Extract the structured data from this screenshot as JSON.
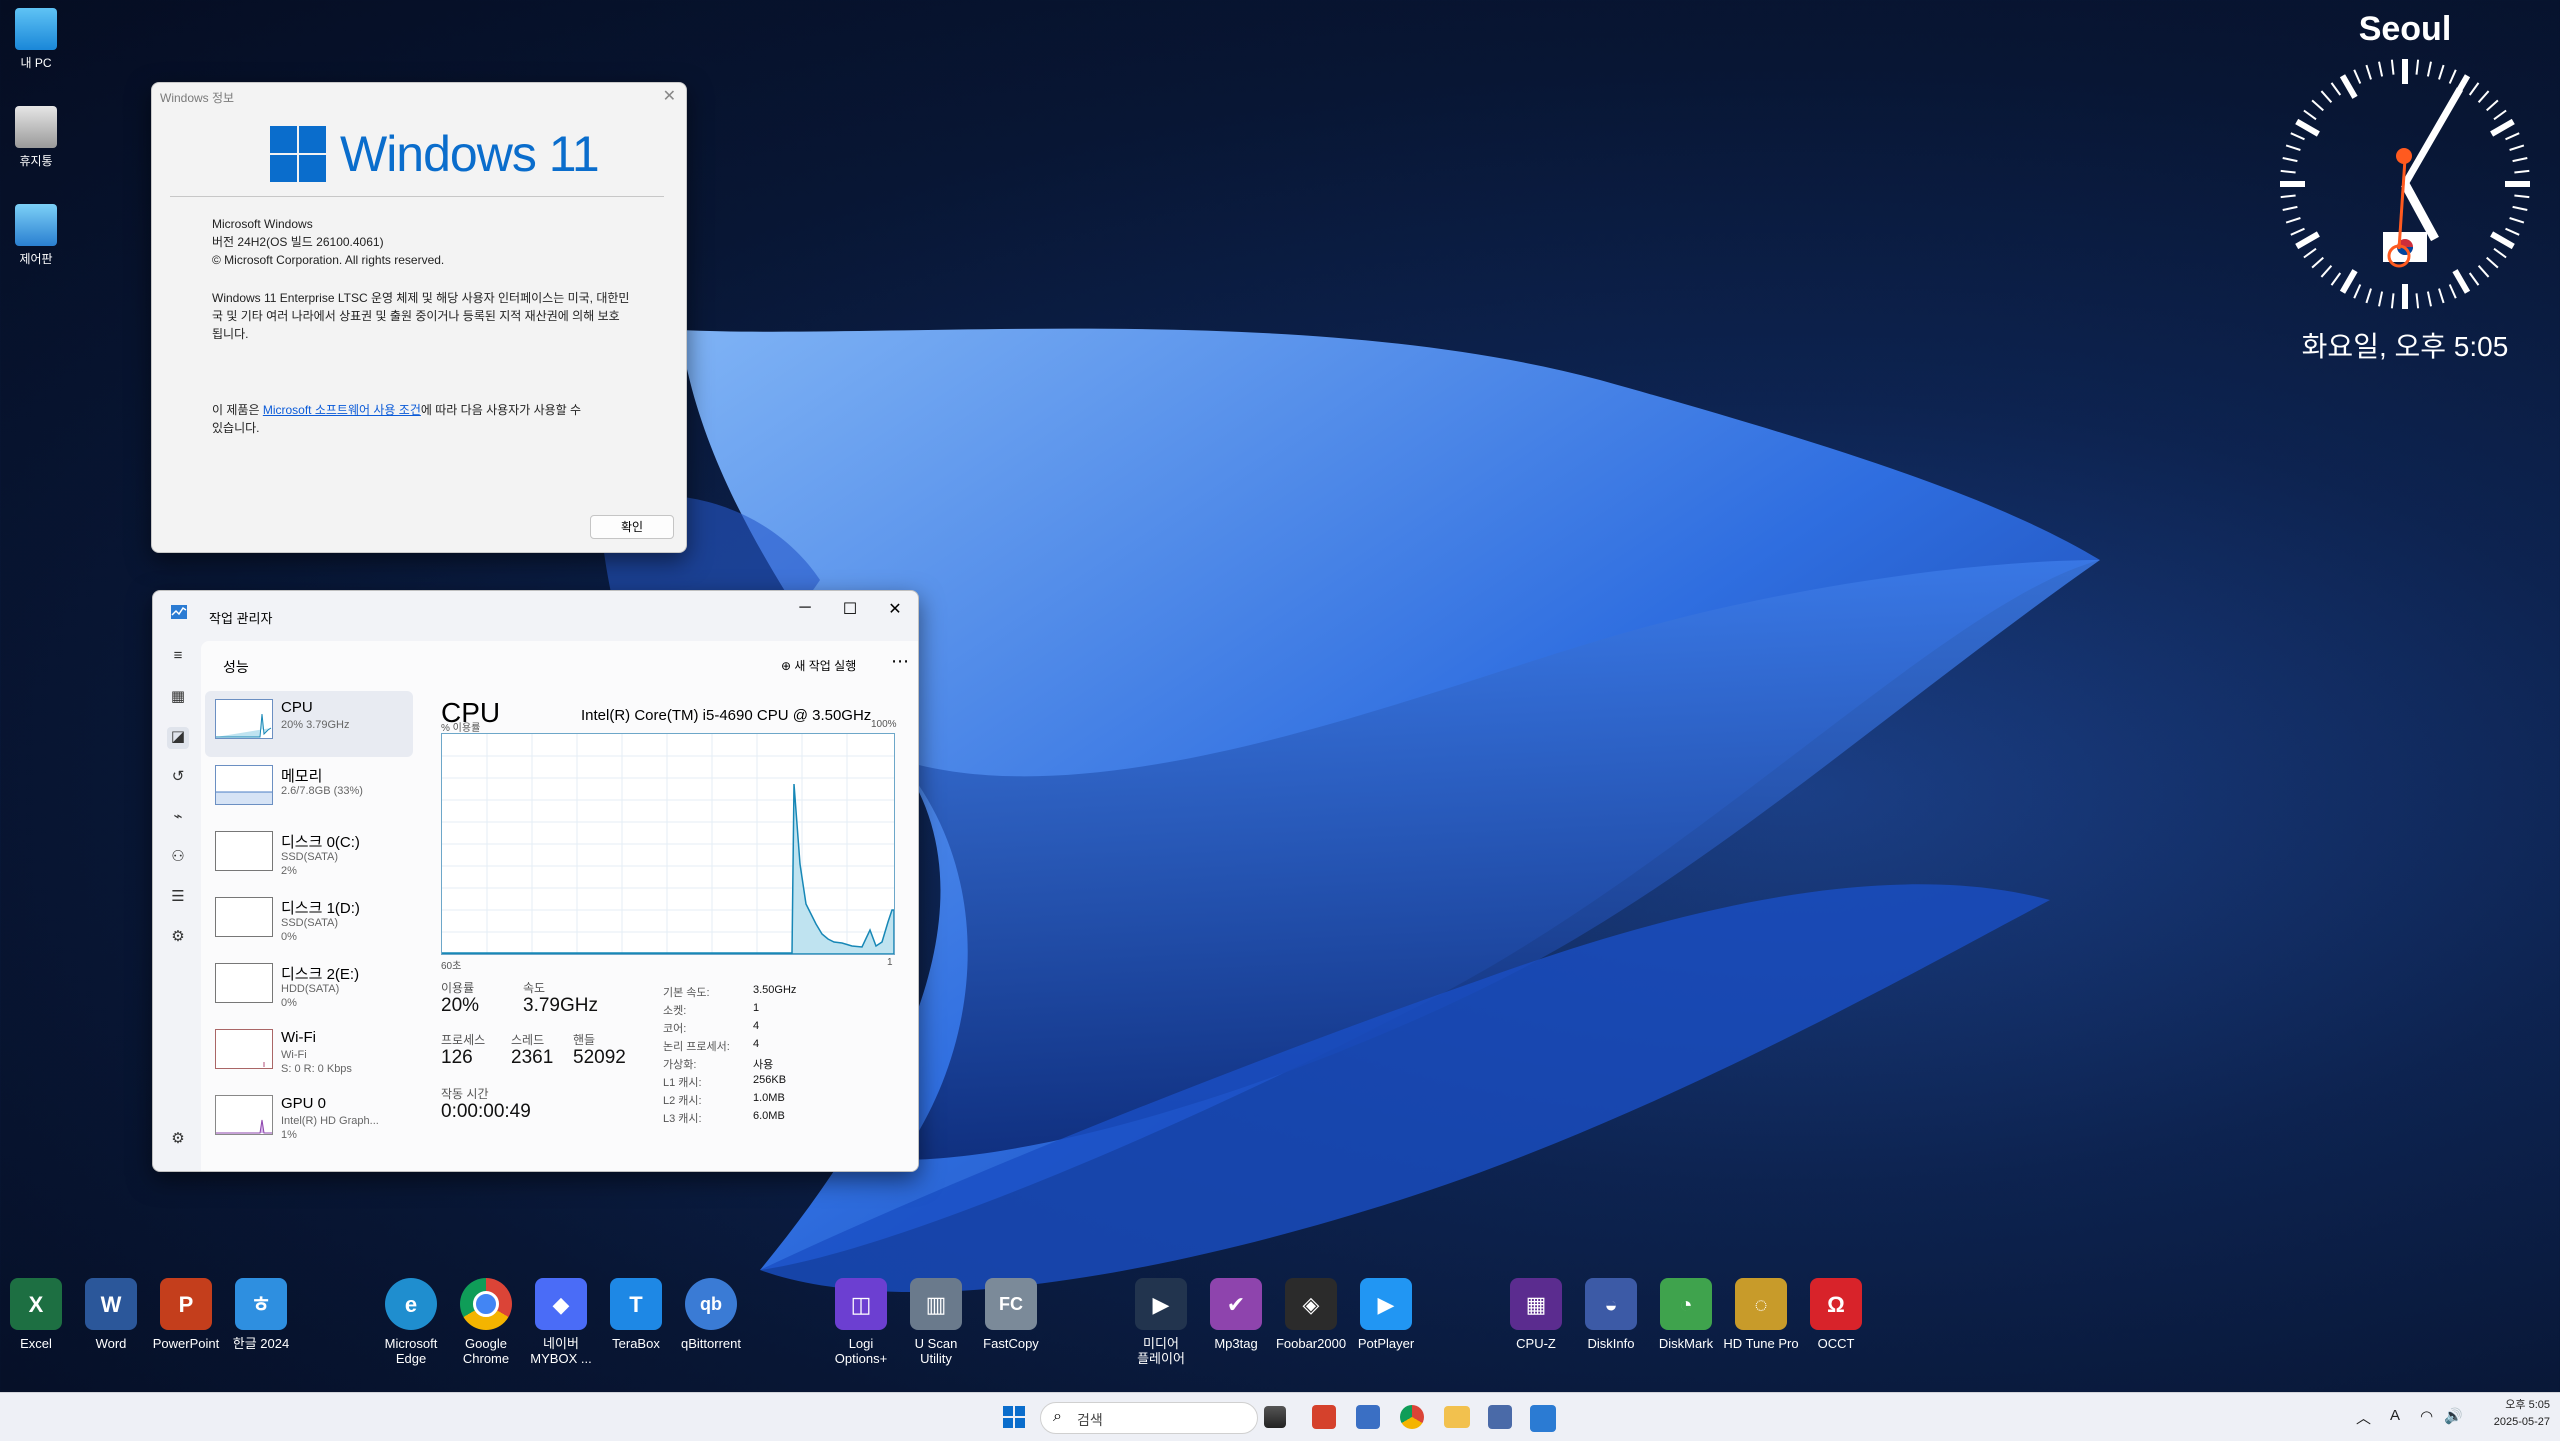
{
  "desktop_icons": [
    {
      "label": "내 PC"
    },
    {
      "label": "휴지통"
    },
    {
      "label": "제어판"
    }
  ],
  "clock": {
    "city": "Seoul",
    "datetime": "화요일, 오후 5:05"
  },
  "winver": {
    "title": "Windows 정보",
    "logo_text": "Windows 11",
    "product": "Microsoft Windows",
    "version": "버전 24H2(OS 빌드 26100.4061)",
    "copyright": "© Microsoft Corporation. All rights reserved.",
    "description": "Windows 11 Enterprise LTSC 운영 체제 및 해당 사용자 인터페이스는 미국, 대한민국 및 기타 여러 나라에서 상표권 및 출원 중이거나 등록된 지적 재산권에 의해 보호됩니다.",
    "license_pre": "이 제품은 ",
    "license_link": "Microsoft 소프트웨어 사용 조건",
    "license_post": "에 따라 다음 사용자가 사용할 수 있습니다.",
    "ok_label": "확인"
  },
  "taskmgr": {
    "title": "작업 관리자",
    "section": "성능",
    "new_task": "새 작업 실행",
    "items": [
      {
        "name": "CPU",
        "sub": "20% 3.79GHz"
      },
      {
        "name": "메모리",
        "sub": "2.6/7.8GB (33%)"
      },
      {
        "name": "디스크 0(C:)",
        "sub": "SSD(SATA)",
        "sub2": "2%"
      },
      {
        "name": "디스크 1(D:)",
        "sub": "SSD(SATA)",
        "sub2": "0%"
      },
      {
        "name": "디스크 2(E:)",
        "sub": "HDD(SATA)",
        "sub2": "0%"
      },
      {
        "name": "Wi-Fi",
        "sub": "Wi-Fi",
        "sub2": "S: 0  R: 0 Kbps"
      },
      {
        "name": "GPU 0",
        "sub": "Intel(R) HD Graph...",
        "sub2": "1%"
      }
    ],
    "cpu_title": "CPU",
    "cpu_model": "Intel(R) Core(TM) i5-4690 CPU @ 3.50GHz",
    "y_label": "% 이용률",
    "y_max": "100%",
    "x_left": "60초",
    "x_right": "1",
    "stats": {
      "util_label": "이용률",
      "util": "20%",
      "speed_label": "속도",
      "speed": "3.79GHz",
      "proc_label": "프로세스",
      "proc": "126",
      "thread_label": "스레드",
      "thread": "2361",
      "handle_label": "핸들",
      "handle": "52092",
      "uptime_label": "작동 시간",
      "uptime": "0:00:00:49"
    },
    "props": [
      {
        "k": "기본 속도:",
        "v": "3.50GHz"
      },
      {
        "k": "소켓:",
        "v": "1"
      },
      {
        "k": "코어:",
        "v": "4"
      },
      {
        "k": "논리 프로세서:",
        "v": "4"
      },
      {
        "k": "가상화:",
        "v": "사용"
      },
      {
        "k": "L1 캐시:",
        "v": "256KB"
      },
      {
        "k": "L2 캐시:",
        "v": "1.0MB"
      },
      {
        "k": "L3 캐시:",
        "v": "6.0MB"
      }
    ]
  },
  "dock": [
    {
      "label": "Excel",
      "label2": "",
      "color": "#1d6f42",
      "glyph": "X"
    },
    {
      "label": "Word",
      "label2": "",
      "color": "#2b579a",
      "glyph": "W"
    },
    {
      "label": "PowerPoint",
      "label2": "",
      "color": "#c43e1c",
      "glyph": "P"
    },
    {
      "label": "한글 2024",
      "label2": "",
      "color": "#2e8fe0",
      "glyph": "ㅎ"
    },
    {
      "label": "Microsoft",
      "label2": "Edge",
      "color": "#1f8ecf",
      "glyph": "e"
    },
    {
      "label": "Google",
      "label2": "Chrome",
      "color": "#dd4b39",
      "glyph": "◉"
    },
    {
      "label": "네이버",
      "label2": "MYBOX ...",
      "color": "#4a6cf7",
      "glyph": "◆"
    },
    {
      "label": "TeraBox",
      "label2": "",
      "color": "#1e88e5",
      "glyph": "T"
    },
    {
      "label": "qBittorrent",
      "label2": "",
      "color": "#3a7bd5",
      "glyph": "qb"
    },
    {
      "label": "Logi",
      "label2": "Options+",
      "color": "#6c3fd1",
      "glyph": "◫"
    },
    {
      "label": "U Scan",
      "label2": "Utility",
      "color": "#6a7a8c",
      "glyph": "▥"
    },
    {
      "label": "FastCopy",
      "label2": "",
      "color": "#7b8a99",
      "glyph": "FC"
    },
    {
      "label": "미디어",
      "label2": "플레이어",
      "color": "#22344e",
      "glyph": "▶"
    },
    {
      "label": "Mp3tag",
      "label2": "",
      "color": "#8e44ad",
      "glyph": "✔"
    },
    {
      "label": "Foobar2000",
      "label2": "",
      "color": "#2b2b2b",
      "glyph": "🦊"
    },
    {
      "label": "PotPlayer",
      "label2": "",
      "color": "#2196f3",
      "glyph": "▶"
    },
    {
      "label": "CPU-Z",
      "label2": "",
      "color": "#5b2c8f",
      "glyph": "▦"
    },
    {
      "label": "DiskInfo",
      "label2": "",
      "color": "#3c5aa6",
      "glyph": "◒"
    },
    {
      "label": "DiskMark",
      "label2": "",
      "color": "#3fa34d",
      "glyph": "◔"
    },
    {
      "label": "HD Tune Pro",
      "label2": "",
      "color": "#c89b2a",
      "glyph": "◌"
    },
    {
      "label": "OCCT",
      "label2": "",
      "color": "#d8232a",
      "glyph": "Ω"
    }
  ],
  "taskbar": {
    "search_placeholder": "검색",
    "tray_lang": "A",
    "time": "오후 5:05",
    "date": "2025-05-27"
  }
}
